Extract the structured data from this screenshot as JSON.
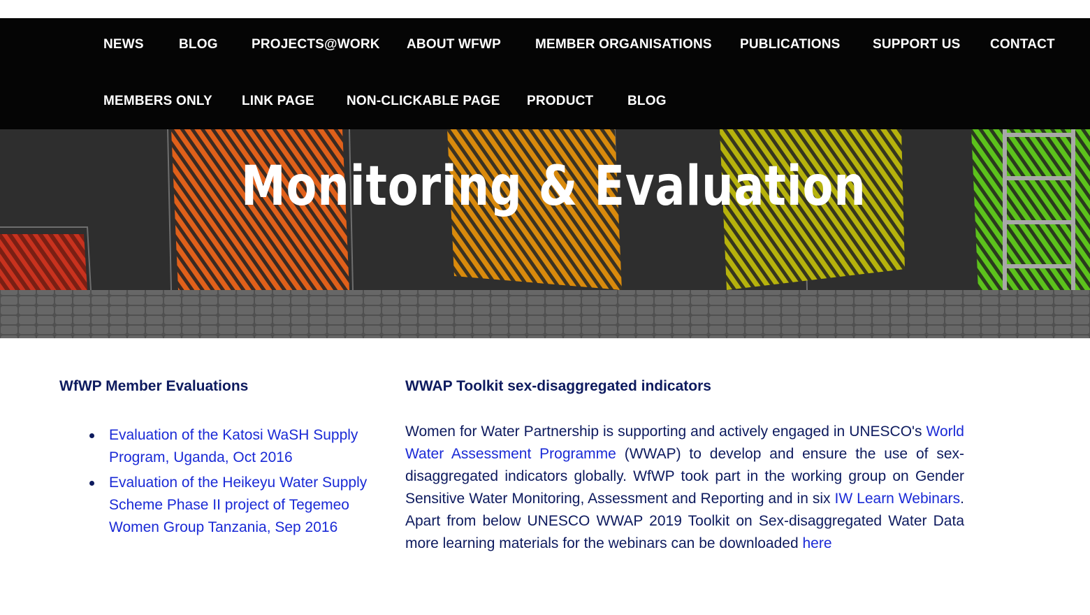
{
  "nav": {
    "row1": [
      "NEWS",
      "BLOG",
      "PROJECTS@WORK",
      "ABOUT WFWP",
      "MEMBER ORGANISATIONS",
      "PUBLICATIONS",
      "SUPPORT US",
      "CONTACT"
    ],
    "row2": [
      "MEMBERS ONLY",
      "LINK PAGE",
      "NON-CLICKABLE PAGE",
      "PRODUCT",
      "BLOG"
    ]
  },
  "hero": {
    "title": "Monitoring & Evaluation"
  },
  "left": {
    "heading": "WfWP Member Evaluations",
    "items": [
      "Evaluation of the Katosi WaSH Supply Program, Uganda, Oct 2016",
      "Evaluation of the Heikeyu Water Supply Scheme Phase II project of Tegemeo Women Group Tanzania, Sep 2016"
    ]
  },
  "right": {
    "heading": "WWAP Toolkit sex-disaggregated indicators",
    "p1": "Women for Water Partnership is supporting and actively engaged in UNESCO's ",
    "link1": "World Water Assessment Programme",
    "p2": " (WWAP) to develop and ensure the use of sex-disaggregated indicators globally. WfWP took part in the working group on Gender Sensitive Water Monitoring, Assessment and Reporting and in six ",
    "link2": "IW Learn Webinars",
    "p3": ". Apart from below UNESCO WWAP 2019 Toolkit on Sex-disaggregated Water Data more learning materials for the webinars can be downloaded ",
    "link3": "here"
  },
  "colors": {
    "nav_bg": "#050505",
    "heading": "#0d1a5e",
    "link": "#1a2ad6",
    "chalk_red": "#c8321e",
    "chalk_orange": "#e0601a",
    "chalk_amber": "#d98a0c",
    "chalk_yellow": "#b6b20c",
    "chalk_green": "#5cc21c"
  }
}
